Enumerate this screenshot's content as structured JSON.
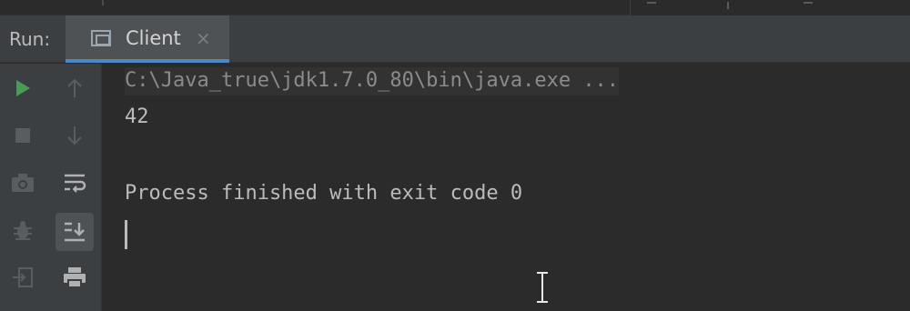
{
  "tool_window": {
    "label": "Run:",
    "tab": {
      "label": "Client",
      "close": "×"
    }
  },
  "toolbar": {
    "left_column": [
      "run-icon",
      "stop-icon",
      "camera-icon",
      "debug-icon",
      "import-icon"
    ],
    "right_column": [
      "up-arrow-icon",
      "down-arrow-icon",
      "soft-wrap-icon",
      "scroll-to-end-icon",
      "print-icon"
    ]
  },
  "console": {
    "command": "C:\\Java_true\\jdk1.7.0_80\\bin\\java.exe ...",
    "output": "42",
    "exit_message": "Process finished with exit code 0"
  },
  "colors": {
    "run": "#499c54",
    "accent": "#4a88c7",
    "background": "#2b2b2b",
    "panel": "#3c3f41"
  }
}
